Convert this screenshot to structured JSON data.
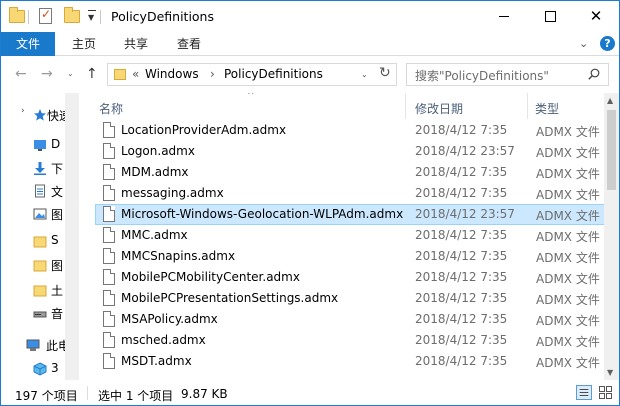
{
  "window": {
    "title": "PolicyDefinitions"
  },
  "ribbon": {
    "file_tab": "文件",
    "tabs": [
      "主页",
      "共享",
      "查看"
    ]
  },
  "address": {
    "prefix": "«",
    "crumbs": [
      "Windows",
      "PolicyDefinitions"
    ]
  },
  "search": {
    "placeholder": "搜索\"PolicyDefinitions\""
  },
  "navpane": {
    "items": [
      {
        "label": "快速",
        "icon": "star-icon"
      },
      {
        "label": "D",
        "icon": "desktop-icon"
      },
      {
        "label": "下",
        "icon": "download-icon"
      },
      {
        "label": "文",
        "icon": "documents-icon"
      },
      {
        "label": "图",
        "icon": "pictures-icon"
      },
      {
        "label": "S",
        "icon": "folder-icon"
      },
      {
        "label": "图",
        "icon": "folder-icon"
      },
      {
        "label": "土",
        "icon": "folder-icon"
      },
      {
        "label": "音",
        "icon": "drive-icon"
      },
      {
        "label": "此电",
        "icon": "computer-icon"
      },
      {
        "label": "3",
        "icon": "cube-icon"
      }
    ]
  },
  "columns": {
    "name": "名称",
    "date": "修改日期",
    "type": "类型"
  },
  "files": [
    {
      "name": "LocationProviderAdm.admx",
      "date": "2018/4/12 7:35",
      "type": "ADMX 文件",
      "selected": false
    },
    {
      "name": "Logon.admx",
      "date": "2018/4/12 23:57",
      "type": "ADMX 文件",
      "selected": false
    },
    {
      "name": "MDM.admx",
      "date": "2018/4/12 7:35",
      "type": "ADMX 文件",
      "selected": false
    },
    {
      "name": "messaging.admx",
      "date": "2018/4/12 7:35",
      "type": "ADMX 文件",
      "selected": false
    },
    {
      "name": "Microsoft-Windows-Geolocation-WLPAdm.admx",
      "date": "2018/4/12 23:57",
      "type": "ADMX 文件",
      "selected": true
    },
    {
      "name": "MMC.admx",
      "date": "2018/4/12 7:35",
      "type": "ADMX 文件",
      "selected": false
    },
    {
      "name": "MMCSnapins.admx",
      "date": "2018/4/12 7:35",
      "type": "ADMX 文件",
      "selected": false
    },
    {
      "name": "MobilePCMobilityCenter.admx",
      "date": "2018/4/12 7:35",
      "type": "ADMX 文件",
      "selected": false
    },
    {
      "name": "MobilePCPresentationSettings.admx",
      "date": "2018/4/12 7:35",
      "type": "ADMX 文件",
      "selected": false
    },
    {
      "name": "MSAPolicy.admx",
      "date": "2018/4/12 7:35",
      "type": "ADMX 文件",
      "selected": false
    },
    {
      "name": "msched.admx",
      "date": "2018/4/12 7:35",
      "type": "ADMX 文件",
      "selected": false
    },
    {
      "name": "MSDT.admx",
      "date": "2018/4/12 7:35",
      "type": "ADMX 文件",
      "selected": false
    }
  ],
  "status": {
    "count": "197 个项目",
    "selection": "选中 1 个项目",
    "size": "9.87 KB"
  },
  "colors": {
    "accent": "#1979ca",
    "selection_bg": "#cce8ff",
    "selection_border": "#99d1ff"
  }
}
